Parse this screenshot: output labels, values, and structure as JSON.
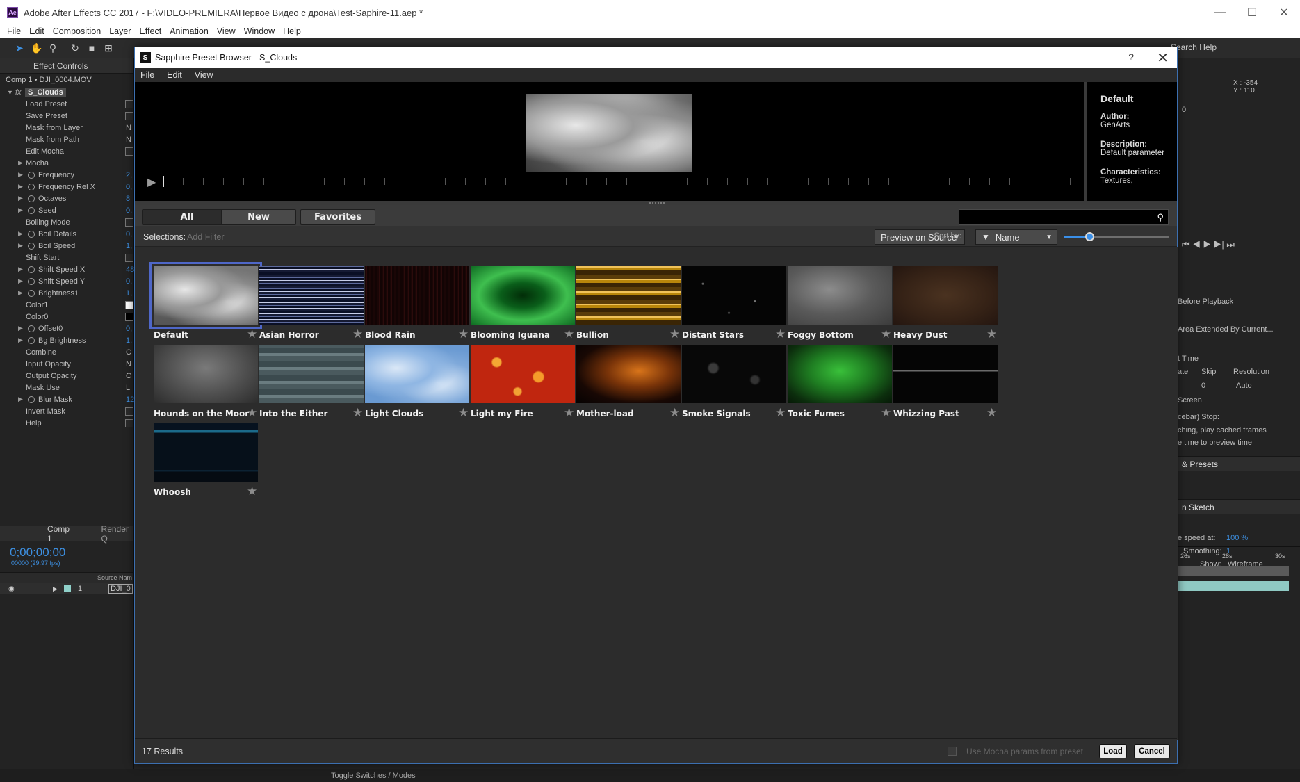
{
  "ae": {
    "title": "Adobe After Effects CC 2017 - F:\\VIDEO-PREMIERA\\Первое Видео с дрона\\Test-Saphire-11.aep *",
    "logo": "Ae",
    "menu": [
      "File",
      "Edit",
      "Composition",
      "Layer",
      "Effect",
      "Animation",
      "View",
      "Window",
      "Help"
    ],
    "search_help": "Search Help"
  },
  "effect_controls": {
    "tab": "Effect Controls",
    "comp_line": "Comp 1 • DJI_0004.MOV",
    "effect_name": "S_Clouds",
    "rows": [
      {
        "label": "Load Preset",
        "ctl": "box"
      },
      {
        "label": "Save Preset",
        "ctl": "box"
      },
      {
        "label": "Mask from Layer",
        "ctl": "N"
      },
      {
        "label": "Mask from Path",
        "ctl": "N"
      },
      {
        "label": "Edit Mocha",
        "ctl": "box"
      },
      {
        "label": "Mocha",
        "tri": true,
        "noico": true
      },
      {
        "label": "Frequency",
        "tri": true,
        "val": "2,"
      },
      {
        "label": "Frequency Rel X",
        "tri": true,
        "val": "0,"
      },
      {
        "label": "Octaves",
        "tri": true,
        "val": "8"
      },
      {
        "label": "Seed",
        "tri": true,
        "val": "0,"
      },
      {
        "label": "Boiling Mode",
        "ctl": "box"
      },
      {
        "label": "Boil Details",
        "tri": true,
        "val": "0,"
      },
      {
        "label": "Boil Speed",
        "tri": true,
        "val": "1,"
      },
      {
        "label": "Shift Start",
        "ctl": "box"
      },
      {
        "label": "Shift Speed X",
        "tri": true,
        "val": "48"
      },
      {
        "label": "Shift Speed Y",
        "tri": true,
        "val": "0,"
      },
      {
        "label": "Brightness1",
        "tri": true,
        "val": "1,"
      },
      {
        "label": "Color1",
        "ctl": "white"
      },
      {
        "label": "Color0",
        "ctl": "black"
      },
      {
        "label": "Offset0",
        "tri": true,
        "val": "0,"
      },
      {
        "label": "Bg Brightness",
        "tri": true,
        "val": "1,"
      },
      {
        "label": "Combine",
        "ctl": "C"
      },
      {
        "label": "Input Opacity",
        "ctl": "N"
      },
      {
        "label": "Output Opacity",
        "ctl": "C"
      },
      {
        "label": "Mask Use",
        "ctl": "L"
      },
      {
        "label": "Blur Mask",
        "tri": true,
        "val": "12"
      },
      {
        "label": "Invert Mask",
        "ctl": "box"
      },
      {
        "label": "Help",
        "ctl": "box",
        "noico": true
      }
    ]
  },
  "timeline": {
    "tab": "Comp 1",
    "render_tab": "Render Q",
    "timecode": "0;00;00;00",
    "fps": "00000 (29.97 fps)",
    "source_col": "Source Nam",
    "layer_num": "1",
    "layer_name": "DJI_0"
  },
  "status": {
    "toggle": "Toggle Switches / Modes"
  },
  "right_panel": {
    "xy": "X : -354\nY : 110",
    "zero": "0",
    "before_playback": "Before Playback",
    "area_extended": "Area Extended By Current...",
    "current_time": "t Time",
    "rate": "ate",
    "skip": "Skip",
    "resolution": "Resolution",
    "skip_val": "0",
    "res_val": "Auto",
    "screen": "Screen",
    "spacebar": "cebar) Stop:",
    "caching": "ching, play cached frames",
    "time_to_preview": "e time to preview time",
    "presets_head": "& Presets",
    "sketch_head": "n Sketch",
    "speed_at": "e speed at:",
    "speed_val": "100 %",
    "smoothing": "Smoothing:",
    "smoothing_val": "1",
    "show": "Show:",
    "wireframe": "Wireframe",
    "t26": "26s",
    "t28": "28s",
    "t30": "30s"
  },
  "dialog": {
    "title": "Sapphire Preset Browser - S_Clouds",
    "logo": "S",
    "help": "?",
    "close": "✕",
    "menu": [
      "File",
      "Edit",
      "View"
    ],
    "info": {
      "name": "Default",
      "author_label": "Author:",
      "author": "GenArts",
      "desc_label": "Description:",
      "desc": "Default parameter",
      "char_label": "Characteristics:",
      "chars": "Textures,"
    },
    "filters": [
      "All",
      "New",
      "Favorites"
    ],
    "active_filter": "All",
    "search_placeholder": "",
    "selections_label": "Selections:",
    "add_filter": "Add Filter",
    "preview_mode": "Preview on Source",
    "sort_label": "Sort by:",
    "sort_value": "Name",
    "size_slider": 0.24,
    "presets": [
      {
        "name": "Default",
        "bg": "radial-gradient(ellipse at 30% 40%, #e6e6e6 0%, #999 35%, transparent 60%), radial-gradient(ellipse at 70% 60%, #f0f0f0 0%, #8a8a8a 40%, transparent 65%), linear-gradient(#777, #555)"
      },
      {
        "name": "Asian Horror",
        "bg": "repeating-linear-gradient(0deg, #0a0f25 0 3px, #5d6a9c 3px 4px, #151a33 4px 7px, #c7cde8 7px 8px), #0b0f22"
      },
      {
        "name": "Blood Rain",
        "bg": "repeating-linear-gradient(90deg, #1a0606 0 2px, #2b0b0b 2px 3px, #120404 3px 6px), #150505"
      },
      {
        "name": "Blooming Iguana",
        "bg": "radial-gradient(ellipse at 50% 50%, #022d08 0%, #0a5e1a 30%, #3fbf4f 60%, #0f6b22 100%)"
      },
      {
        "name": "Bullion",
        "bg": "repeating-linear-gradient(0deg, #3a2505 0 6px, #b8860b 6px 10px, #f1c35a 10px 12px, #5a3d0a 12px 18px)"
      },
      {
        "name": "Distant Stars",
        "bg": "radial-gradient(circle at 20% 30%, #666 0 1px, transparent 2px), radial-gradient(circle at 70% 60%, #777 0 1px, transparent 2px), radial-gradient(circle at 45% 80%, #555 0 1px, transparent 2px), #050505"
      },
      {
        "name": "Foggy Bottom",
        "bg": "radial-gradient(ellipse at 40% 40%, #8c8c8c 0%, #5a5a5a 50%, #3c3c3c 100%)"
      },
      {
        "name": "Heavy Dust",
        "bg": "radial-gradient(ellipse at 50% 50%, #4a3220 0%, #352216 60%, #241610 100%)"
      },
      {
        "name": "Hounds on the Moor",
        "bg": "radial-gradient(ellipse at 50% 40%, #7a7a7a 0%, #4e4e4e 55%, #2c2c2c 100%)"
      },
      {
        "name": "Into the Either",
        "bg": "repeating-linear-gradient(0deg, #4a5a5e 0 8px, #6a7c80 8px 12px, #3b4a4e 12px 20px)"
      },
      {
        "name": "Light Clouds",
        "bg": "radial-gradient(ellipse at 30% 40%, #dbe8f7 0%, #8fb6e3 35%, transparent 60%), radial-gradient(ellipse at 70% 65%, #e6f0fb 0%, #7fa9da 40%, transparent 65%), #6a9ad2"
      },
      {
        "name": "Light my Fire",
        "bg": "radial-gradient(circle at 25% 30%, #f4a733 0 6px, transparent 8px), radial-gradient(circle at 65% 55%, #f59b2a 0 7px, transparent 9px), radial-gradient(circle at 45% 80%, #f2a234 0 5px, transparent 7px), #c0260f"
      },
      {
        "name": "Mother-load",
        "bg": "radial-gradient(ellipse at 60% 45%, #d8741a 0%, #7a3409 35%, #180804 70%, #050202 100%)"
      },
      {
        "name": "Smoke Signals",
        "bg": "radial-gradient(circle at 30% 40%, #3a3a3a 0 6px, transparent 9px), radial-gradient(circle at 70% 60%, #333 0 5px, transparent 8px), #080808"
      },
      {
        "name": "Toxic Fumes",
        "bg": "radial-gradient(ellipse at 50% 45%, #39c03a 0%, #1f7e22 40%, #0c2e0d 80%, #061806 100%)"
      },
      {
        "name": "Whizzing Past",
        "bg": "linear-gradient(#050505 0 44%, #6a6a6a 44% 46%, #050505 46%)"
      },
      {
        "name": "Whoosh",
        "bg": "linear-gradient(#07121f 0 12%, #1b6a8a 12% 16%, #06101a 16% 80%, #0c2233 80% 83%, #050b12 83%)"
      }
    ],
    "results": "17 Results",
    "mocha_option": "Use Mocha params from preset",
    "load": "Load",
    "cancel": "Cancel"
  }
}
